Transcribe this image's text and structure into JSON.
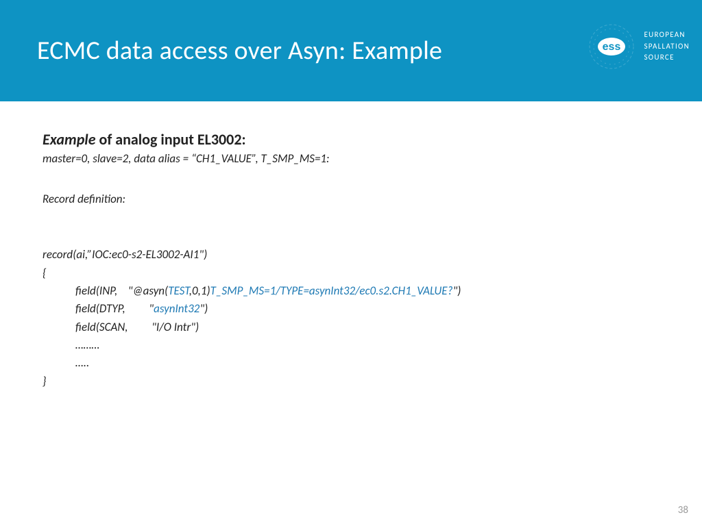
{
  "header": {
    "title": "ECMC data access over Asyn: Example",
    "org_line1": "EUROPEAN",
    "org_line2": "SPALLATION",
    "org_line3": "SOURCE",
    "logo_text": "ess"
  },
  "body": {
    "subtitle_em": "Example",
    "subtitle_rest": " of analog input EL3002:",
    "meta": "master=0, slave=2, data alias = “CH1_VALUE”, T_SMP_MS=1:",
    "rec_def_label": "Record definition:",
    "code": {
      "l1": "record(ai,”IOC:ec0-s2-EL3002-AI1\")",
      "l2": "{",
      "l3_a": "field(INP,    \"@asyn(",
      "l3_b": "TEST",
      "l3_c": ",0,1)",
      "l3_d": "T_SMP_MS=1/TYPE=asynInt32/ec0.s2.CH1_VALUE?",
      "l3_e": "\")",
      "l4_a": "field(DTYP,         \"",
      "l4_b": "asynInt32",
      "l4_c": "\")",
      "l5": "field(SCAN,         \"I/O Intr\")",
      "l6": "………",
      "l7": "…..",
      "l8": "}"
    }
  },
  "page_number": "38"
}
